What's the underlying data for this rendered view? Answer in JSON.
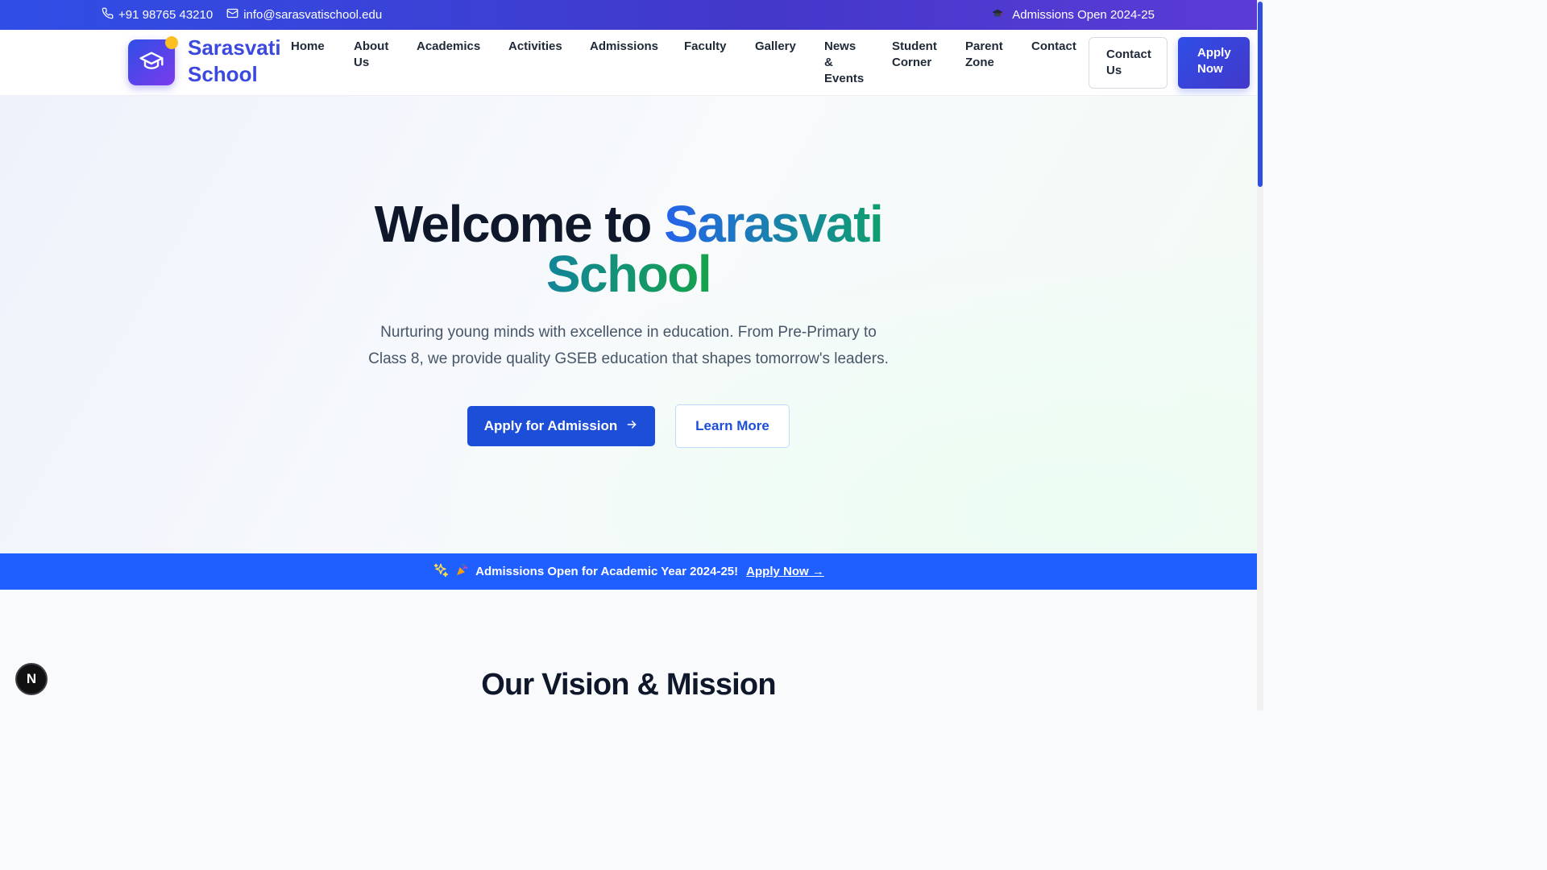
{
  "topbar": {
    "phone": "+91 98765 43210",
    "email": "info@sarasvatischool.edu",
    "admissions": "Admissions Open 2024-25",
    "icons": [
      "phone-icon",
      "mail-icon",
      "graduation-cap-icon"
    ]
  },
  "header": {
    "brand_line1": "Sarasvati",
    "brand_line2": "School",
    "logo_icon": "graduation-cap-icon",
    "nav": {
      "home": "Home",
      "about_1": "About",
      "about_2": "Us",
      "academics": "Academics",
      "activities": "Activities",
      "admissions": "Admissions",
      "faculty": "Faculty",
      "gallery": "Gallery",
      "news_1": "News",
      "news_2": "&",
      "news_3": "Events",
      "student_1": "Student",
      "student_2": "Corner",
      "parent_1": "Parent",
      "parent_2": "Zone",
      "contact": "Contact"
    },
    "contact_btn_1": "Contact",
    "contact_btn_2": "Us",
    "apply_btn_1": "Apply",
    "apply_btn_2": "Now"
  },
  "hero": {
    "title_plain": "Welcome to ",
    "title_accent": "Sarasvati",
    "title_line2": "School",
    "subtitle_line1": "Nurturing young minds with excellence in education. From Pre-Primary to",
    "subtitle_line2": "Class 8, we provide quality GSEB education that shapes tomorrow's leaders.",
    "primary_cta": "Apply for Admission",
    "secondary_cta": "Learn More"
  },
  "announcement": {
    "text": "Admissions Open for Academic Year 2024-25!",
    "link": "Apply Now →",
    "icons": [
      "sparkles-icon",
      "party-popper-icon"
    ]
  },
  "vision": {
    "heading": "Our Vision & Mission"
  },
  "badge": {
    "letter": "N"
  },
  "colors": {
    "primary": "#1d4ed8",
    "topbar_gradient_start": "#2f4ee6",
    "topbar_gradient_end": "#5b3bd6",
    "accent_green": "#16a34a",
    "announcement_bg": "#1f5eff"
  }
}
